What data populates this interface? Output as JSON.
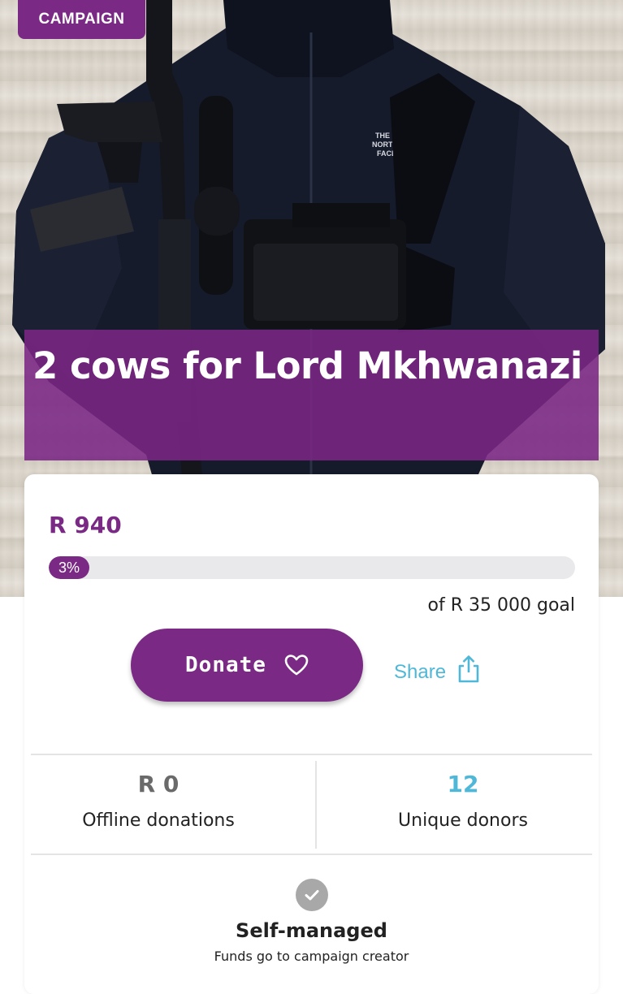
{
  "badge": {
    "label": "CAMPAIGN"
  },
  "campaign": {
    "title": "2 cows for Lord Mkhwanazi"
  },
  "funding": {
    "raised": "R 940",
    "progress_label": "3%",
    "progress_fraction": 0.03,
    "goal_text": "of R 35 000 goal"
  },
  "actions": {
    "donate_label": "Donate",
    "donate_icon": "heart-outline-icon",
    "share_label": "Share",
    "share_icon": "share-upload-icon"
  },
  "stats": [
    {
      "value": "R 0",
      "label": "Offline donations"
    },
    {
      "value": "12",
      "label": "Unique donors"
    }
  ],
  "management": {
    "icon": "check-circle-icon",
    "title": "Self-managed",
    "subtitle": "Funds go to campaign creator"
  },
  "colors": {
    "brand_purple": "#7a2a84",
    "accent_blue": "#4fb8d8",
    "muted_gray": "#6a6a6a"
  }
}
